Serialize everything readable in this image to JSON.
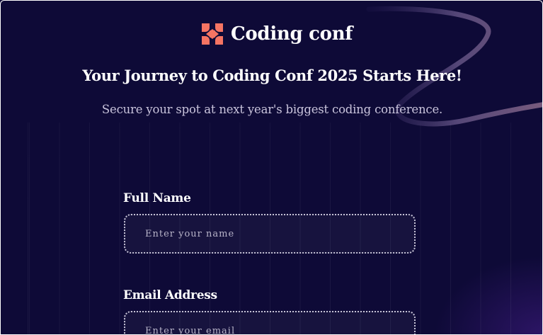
{
  "brand": {
    "name": "Coding conf",
    "logo_icon": "coding-conf-logo-icon",
    "logo_color": "#f57463"
  },
  "hero": {
    "headline": "Your Journey to Coding Conf 2025 Starts Here!",
    "subtext": "Secure your spot at next year's biggest coding conference."
  },
  "form": {
    "full_name": {
      "label": "Full Name",
      "placeholder": "Enter your name",
      "value": ""
    },
    "email": {
      "label": "Email Address",
      "placeholder": "Enter your email",
      "value": ""
    }
  },
  "colors": {
    "background": "#0e0a37",
    "accent": "#f57463",
    "input_border": "#c6c3d6",
    "muted_text": "#c9c4dc"
  }
}
